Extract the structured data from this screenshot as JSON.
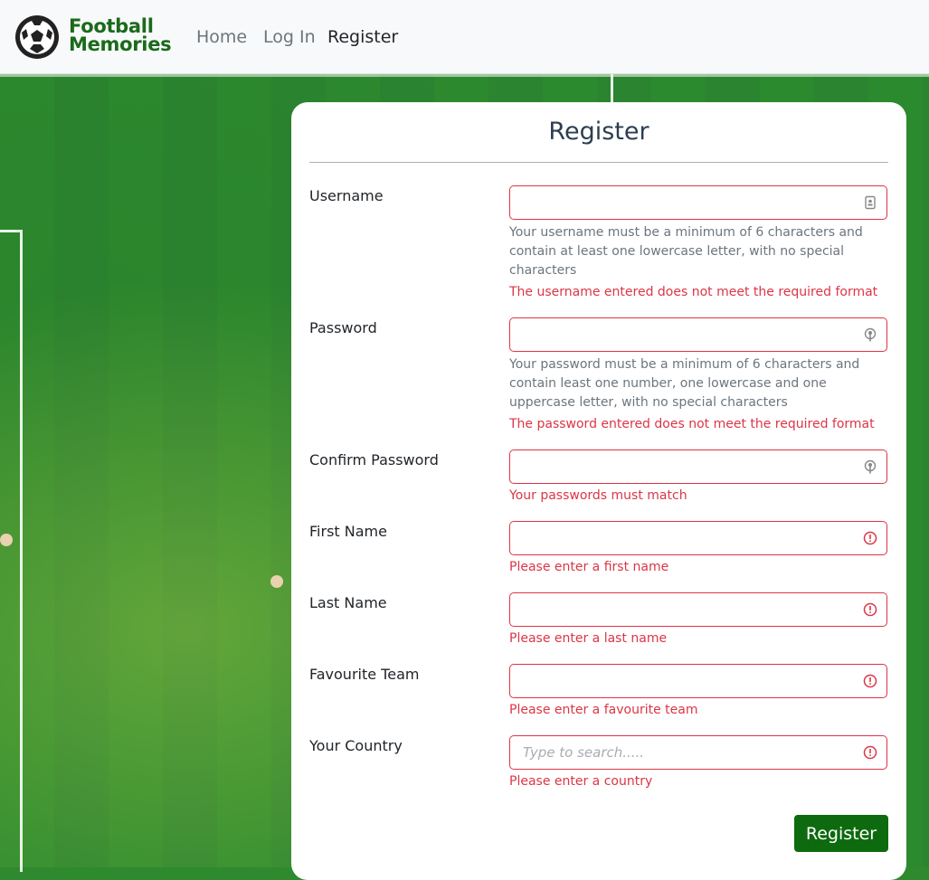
{
  "nav": {
    "brand_line1": "Football",
    "brand_line2": "Memories",
    "links": [
      {
        "label": "Home",
        "active": false
      },
      {
        "label": "Log In",
        "active": false
      },
      {
        "label": "Register",
        "active": true
      }
    ]
  },
  "form": {
    "title": "Register",
    "fields": {
      "username": {
        "label": "Username",
        "value": "",
        "icon": "contact-card-icon",
        "hint": "Your username must be a minimum of 6 characters and contain at least one lowercase letter, with no special characters",
        "error": "The username entered does not meet the required format"
      },
      "password": {
        "label": "Password",
        "value": "",
        "icon": "key-icon",
        "hint": "Your password must be a minimum of 6 characters and contain least one number, one lowercase and one uppercase letter, with no special characters",
        "error": "The password entered does not meet the required format"
      },
      "confirm_password": {
        "label": "Confirm Password",
        "value": "",
        "icon": "key-icon",
        "error": "Your passwords must match"
      },
      "first_name": {
        "label": "First Name",
        "value": "",
        "icon": "error-circle-icon",
        "error": "Please enter a first name"
      },
      "last_name": {
        "label": "Last Name",
        "value": "",
        "icon": "error-circle-icon",
        "error": "Please enter a last name"
      },
      "favourite_team": {
        "label": "Favourite Team",
        "value": "",
        "icon": "error-circle-icon",
        "error": "Please enter a favourite team"
      },
      "country": {
        "label": "Your Country",
        "value": "",
        "placeholder": "Type to search.....",
        "icon": "error-circle-icon",
        "error": "Please enter a country"
      }
    },
    "submit_label": "Register"
  },
  "colors": {
    "brand": "#1a6a1a",
    "error": "#dc3545",
    "button": "#0e6a0e",
    "pitch": "#2c8a2e"
  }
}
